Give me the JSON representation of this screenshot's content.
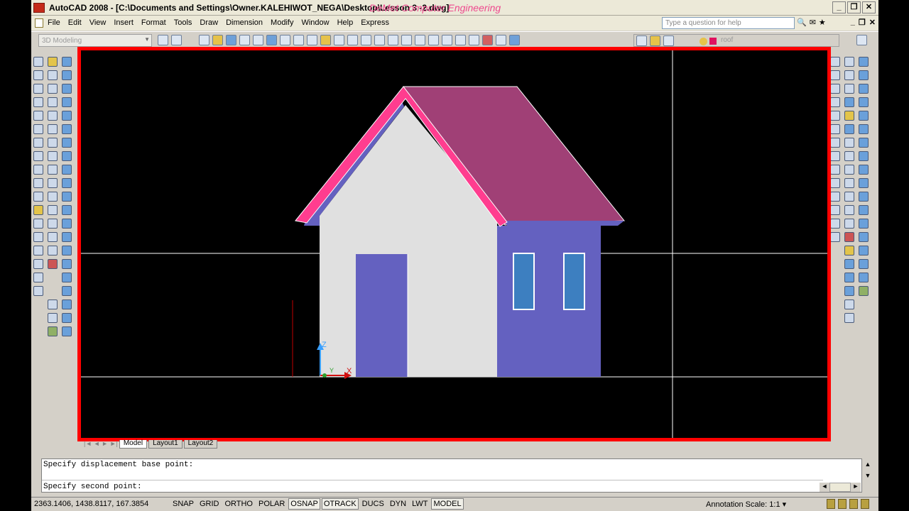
{
  "app": {
    "title": "AutoCAD 2008 - [C:\\Documents and Settings\\Owner.KALEHIWOT_NEGA\\Desktop\\Lesson 3 -2.dwg]",
    "watermark": "DeMet Computer Engineering"
  },
  "window_controls": [
    "_",
    "❐",
    "✕"
  ],
  "menu": [
    "File",
    "Edit",
    "View",
    "Insert",
    "Format",
    "Tools",
    "Draw",
    "Dimension",
    "Modify",
    "Window",
    "Help",
    "Express"
  ],
  "help_search": {
    "placeholder": "Type a question for help"
  },
  "toolbar": {
    "workspace": "3D Modeling",
    "layer": "roof"
  },
  "layout_tabs": [
    "Model",
    "Layout1",
    "Layout2"
  ],
  "active_tab": "Model",
  "command_line": {
    "line1": "Specify displacement base point:",
    "line2": "Specify second point:"
  },
  "status": {
    "coords": "2363.1406, 1438.8117, 167.3854",
    "toggles": [
      {
        "label": "SNAP",
        "on": false
      },
      {
        "label": "GRID",
        "on": false
      },
      {
        "label": "ORTHO",
        "on": false
      },
      {
        "label": "POLAR",
        "on": false
      },
      {
        "label": "OSNAP",
        "on": true
      },
      {
        "label": "OTRACK",
        "on": true
      },
      {
        "label": "DUCS",
        "on": false
      },
      {
        "label": "DYN",
        "on": false
      },
      {
        "label": "LWT",
        "on": false
      },
      {
        "label": "MODEL",
        "on": true
      }
    ],
    "annotation_scale_label": "Annotation Scale:",
    "annotation_scale_value": "1:1"
  },
  "drawing": {
    "ucs_axes": [
      "Z",
      "Y",
      "X"
    ],
    "colors": {
      "frame": "#ff0000",
      "wall": "#e0e0e0",
      "side_wall": "#6461c0",
      "roof": "#a04076",
      "roof_edge": "#ff3d8f",
      "window": "#3d7fc0",
      "crosshair": "#ffffff"
    }
  }
}
